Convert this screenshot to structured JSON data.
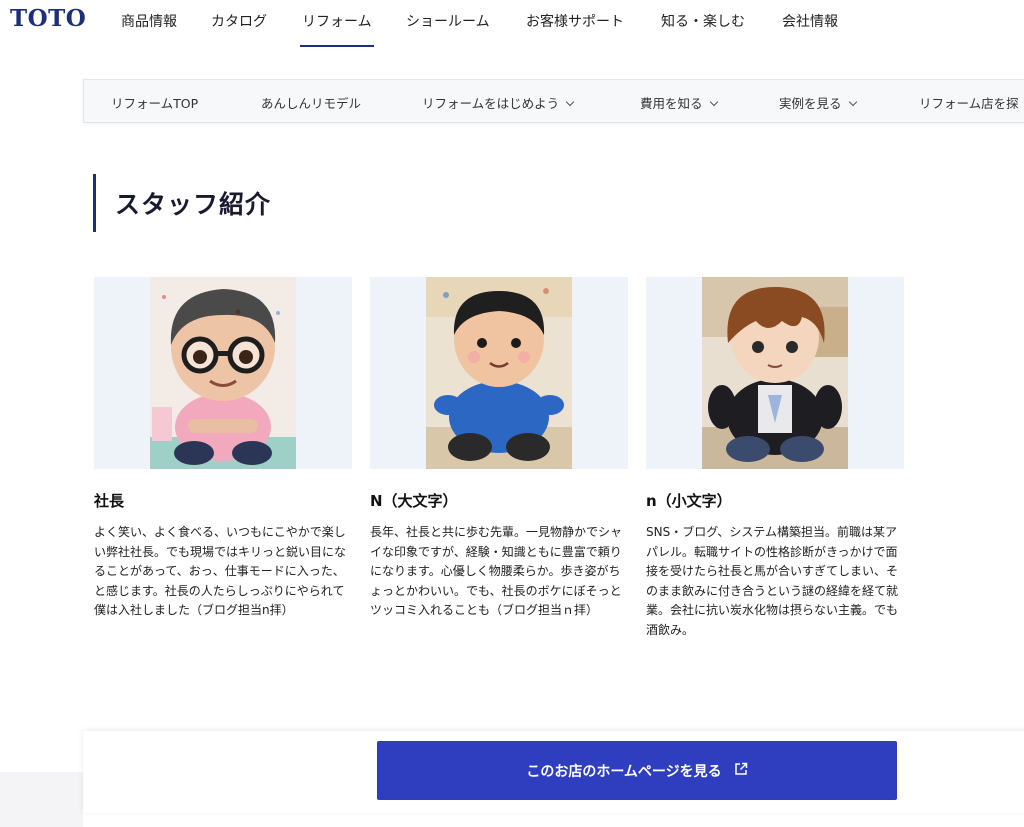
{
  "header": {
    "logo": "TOTO",
    "nav": [
      "商品情報",
      "カタログ",
      "リフォーム",
      "ショールーム",
      "お客様サポート",
      "知る・楽しむ",
      "会社情報"
    ],
    "active_index": 2
  },
  "subnav": {
    "items": [
      "リフォームTOP",
      "あんしんリモデル",
      "リフォームをはじめよう",
      "費用を知る",
      "実例を見る",
      "リフォーム店を探"
    ]
  },
  "page": {
    "title": "スタッフ紹介"
  },
  "staff": [
    {
      "name": "社長",
      "description": "よく笑い、よく食べる、いつもにこやかで楽しい弊社社長。でも現場ではキリっと鋭い目になることがあって、おっ、仕事モードに入った、と感じます。社長の人たらしっぷりにやられて僕は入社しました（ブログ担当n拝）"
    },
    {
      "name": "N（大文字）",
      "description": "長年、社長と共に歩む先輩。一見物静かでシャイな印象ですが、経験・知識ともに豊富で頼りになります。心優しく物腰柔らか。歩き姿がちょっとかわいい。でも、社長のボケにぼそっとツッコミ入れることも（ブログ担当ｎ拝）"
    },
    {
      "name": "n（小文字）",
      "description": "SNS・ブログ、システム構築担当。前職は某アパレル。転職サイトの性格診断がきっかけで面接を受けたら社長と馬が合いすぎてしまい、そのまま飲みに付き合うという謎の経緯を経て就業。会社に抗い炭水化物は摂らない主義。でも酒飲み。"
    }
  ],
  "cta": {
    "label": "このお店のホームページを見る"
  },
  "colors": {
    "brand": "#1d2f7c",
    "cta": "#2f3dbf"
  }
}
